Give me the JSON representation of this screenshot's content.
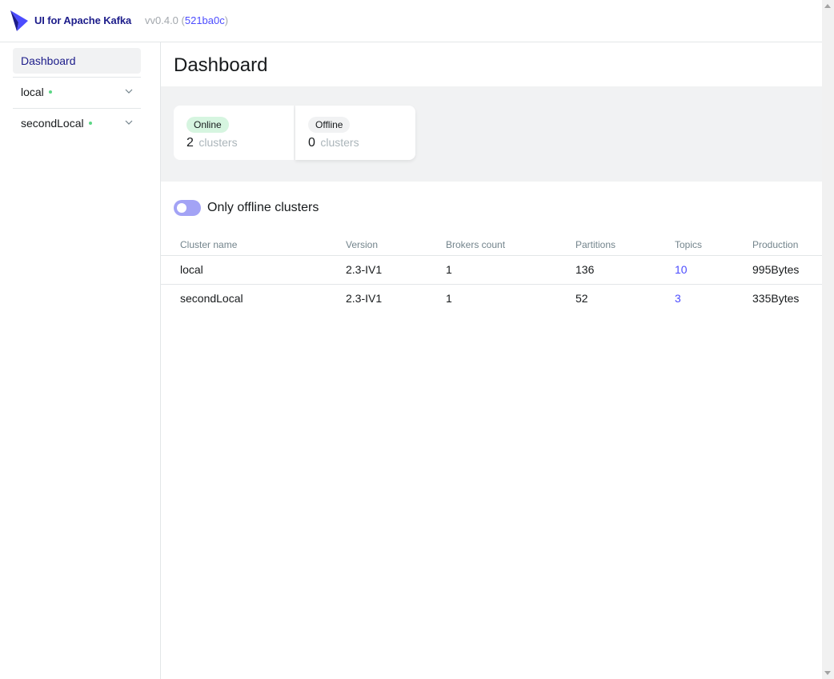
{
  "header": {
    "brand": "UI for Apache Kafka",
    "version_prefix": "vv0.4.0 (",
    "commit": "521ba0c",
    "version_suffix": ")"
  },
  "sidebar": {
    "dashboard_label": "Dashboard",
    "clusters": [
      {
        "name": "local",
        "status": "online"
      },
      {
        "name": "secondLocal",
        "status": "online"
      }
    ]
  },
  "main": {
    "title": "Dashboard",
    "metrics": {
      "online": {
        "badge": "Online",
        "count": "2",
        "unit": "clusters"
      },
      "offline": {
        "badge": "Offline",
        "count": "0",
        "unit": "clusters"
      }
    },
    "toggle_label": "Only offline clusters",
    "table": {
      "headers": [
        "Cluster name",
        "Version",
        "Brokers count",
        "Partitions",
        "Topics",
        "Production"
      ],
      "rows": [
        [
          "local",
          "2.3-IV1",
          "1",
          "136",
          "10",
          "995Bytes"
        ],
        [
          "secondLocal",
          "2.3-IV1",
          "1",
          "52",
          "3",
          "335Bytes"
        ]
      ]
    }
  },
  "colors": {
    "brand": "#1c1c8a",
    "link": "#4c4cff",
    "online_dot": "#5cd685",
    "online_badge_bg": "#d6f5e0",
    "toggle_bg": "#a3a3f5"
  }
}
